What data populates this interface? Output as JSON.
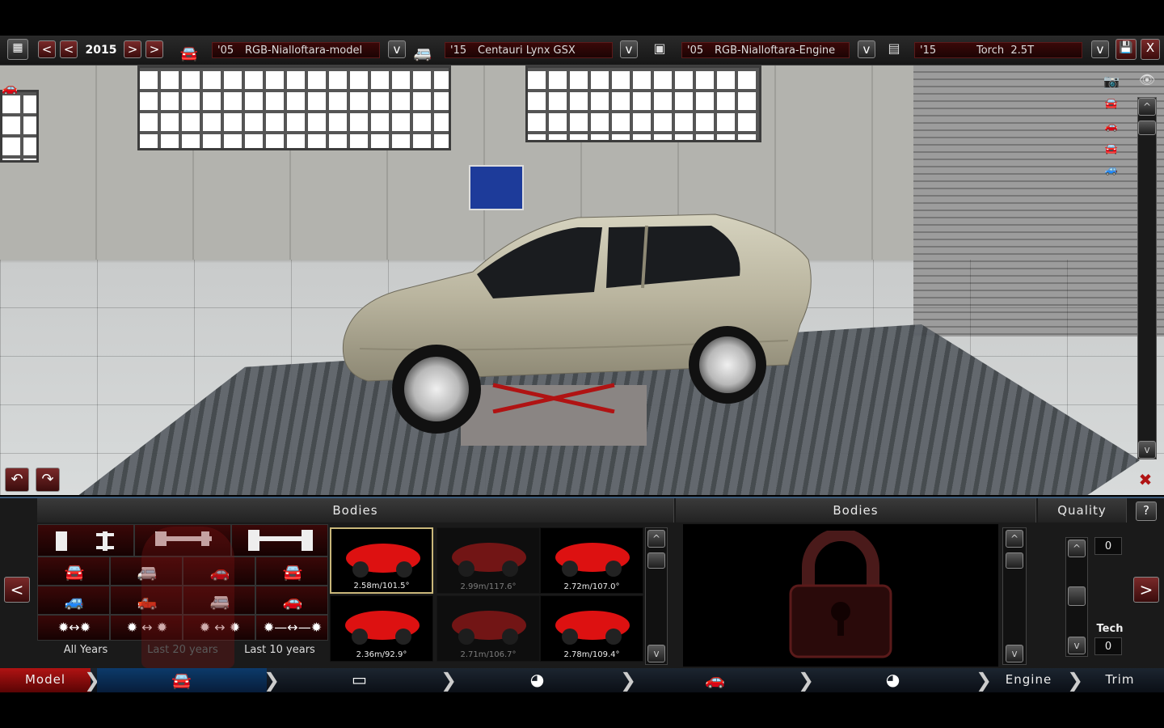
{
  "topbar": {
    "calendar_icon": "calendar-icon",
    "year": "2015",
    "model_dropdown": {
      "year": "'05",
      "name": "RGB-Nialloftara-model"
    },
    "family_dropdown": {
      "year": "'15",
      "name": "Centauri Lynx GSX"
    },
    "engine_dropdown": {
      "year": "'05",
      "name": "RGB-Nialloftara-Engine"
    },
    "engine_variant_dropdown": {
      "year": "'15",
      "name": "Torch  2.5T"
    },
    "prev_label": "<",
    "next_label": ">",
    "dropdown_arrow": "v",
    "close_label": "X"
  },
  "body_panel": {
    "header": "Bodies",
    "year_filters": [
      "All Years",
      "Last 20 years",
      "Last 10 years"
    ],
    "thumbs": [
      {
        "label": "2.58m/101.5°",
        "selected": true,
        "locked": false
      },
      {
        "label": "2.99m/117.6°",
        "selected": false,
        "locked": true
      },
      {
        "label": "2.72m/107.0°",
        "selected": false,
        "locked": false
      },
      {
        "label": "2.36m/92.9°",
        "selected": false,
        "locked": false
      },
      {
        "label": "2.71m/106.7°",
        "selected": false,
        "locked": true
      },
      {
        "label": "2.78m/109.4°",
        "selected": false,
        "locked": false
      }
    ],
    "up_label": "^",
    "down_label": "v"
  },
  "detail_panel": {
    "header": "Bodies"
  },
  "quality_panel": {
    "header": "Quality",
    "help_label": "?",
    "quality_value": "0",
    "tech_label": "Tech",
    "tech_value": "0"
  },
  "nav": {
    "model": "Model",
    "engine": "Engine",
    "trim": "Trim",
    "left_arrow": "<",
    "right_arrow": ">"
  },
  "colors": {
    "accent_red": "#b01313",
    "accent_blue": "#0c3a6a",
    "selection_gold": "#c9b77a"
  }
}
